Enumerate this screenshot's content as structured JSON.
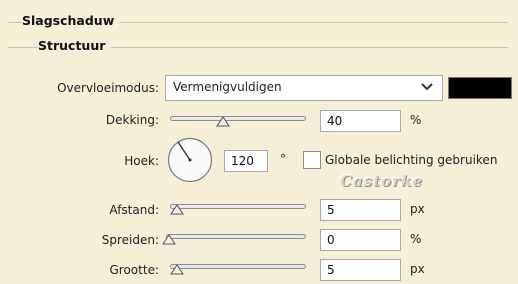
{
  "panel": {
    "section_title": "Slagschaduw",
    "subsection_title": "Structuur"
  },
  "blend_mode": {
    "label": "Overvloeimodus:",
    "value": "Vermenigvuldigen",
    "color": "#000000"
  },
  "opacity": {
    "label": "Dekking:",
    "value": "40",
    "unit": "%",
    "slider_level": 0.4
  },
  "angle": {
    "label": "Hoek:",
    "value": "120",
    "unit": "°",
    "global_light_label": "Globale belichting gebruiken",
    "global_light_checked": false
  },
  "watermark": "Castorke",
  "distance": {
    "label": "Afstand:",
    "value": "5",
    "unit": "px",
    "slider_level": 0.02
  },
  "spread": {
    "label": "Spreiden:",
    "value": "0",
    "unit": "%",
    "slider_level": 0.0
  },
  "size": {
    "label": "Grootte:",
    "value": "5",
    "unit": "px",
    "slider_level": 0.02
  }
}
